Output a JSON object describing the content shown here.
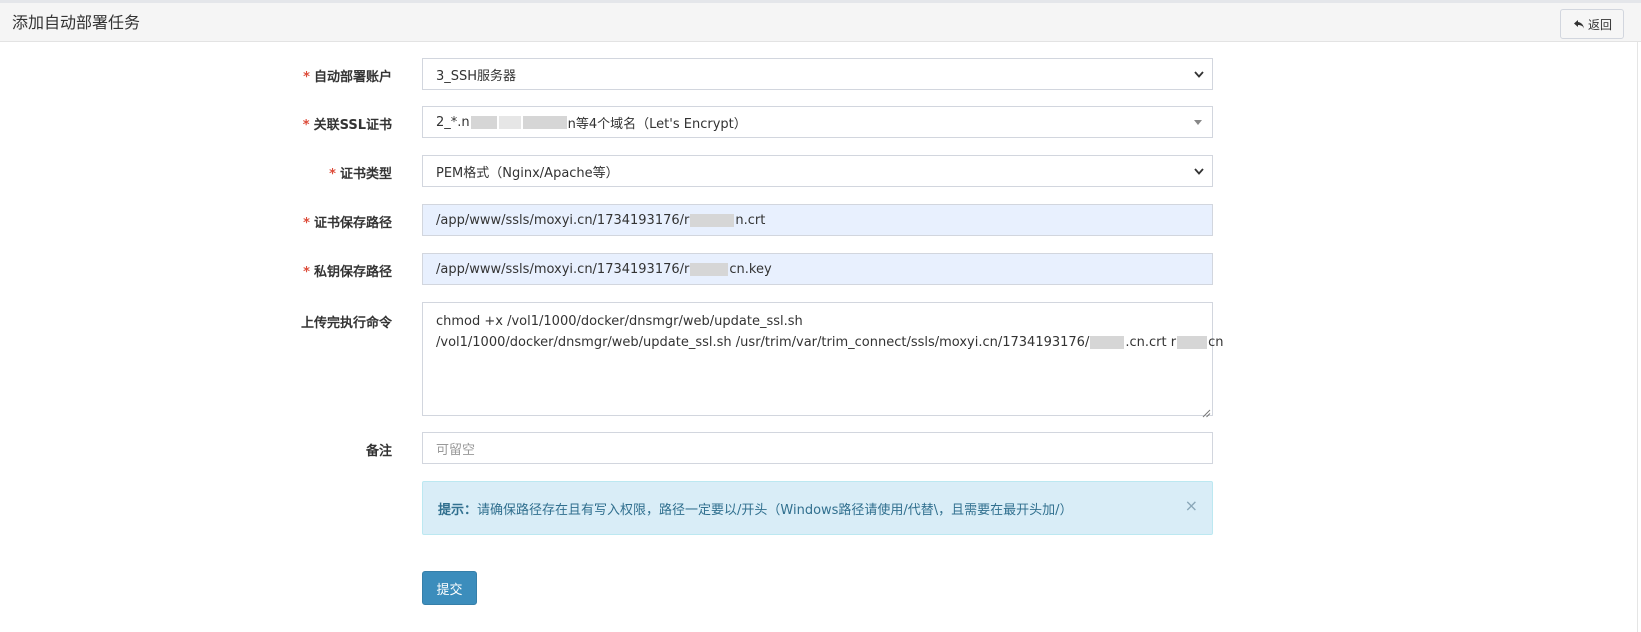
{
  "header": {
    "title": "添加自动部署任务",
    "back_label": "返回"
  },
  "form": {
    "account": {
      "label": "自动部署账户",
      "value": "3_SSH服务器"
    },
    "certificate": {
      "label": "关联SSL证书",
      "value_prefix": "2_*.n",
      "value_suffix": "n等4个域名（Let's Encrypt）"
    },
    "cert_type": {
      "label": "证书类型",
      "value": "PEM格式（Nginx/Apache等）"
    },
    "cert_path": {
      "label": "证书保存路径",
      "value_prefix": "/app/www/ssls/moxyi.cn/1734193176/r",
      "value_suffix": "n.crt"
    },
    "key_path": {
      "label": "私钥保存路径",
      "value_prefix": "/app/www/ssls/moxyi.cn/1734193176/r",
      "value_suffix": "cn.key"
    },
    "command": {
      "label": "上传完执行命令",
      "line1": "chmod +x /vol1/1000/docker/dnsmgr/web/update_ssl.sh",
      "line2_prefix": "/vol1/1000/docker/dnsmgr/web/update_ssl.sh /usr/trim/var/trim_connect/ssls/moxyi.cn/1734193176/",
      "line2_mid": ".cn.crt r",
      "line2_suffix": "cn"
    },
    "note": {
      "label": "备注",
      "placeholder": "可留空"
    }
  },
  "alert": {
    "strong": "提示：",
    "text": "请确保路径存在且有写入权限，路径一定要以/开头（Windows路径请使用/代替\\，且需要在最开头加/）",
    "close": "×"
  },
  "submit_label": "提交",
  "colors": {
    "primary": "#3c8dbc",
    "required": "#dd4b39",
    "alert_bg": "#d9edf7",
    "autofill_bg": "#e8f0fe"
  }
}
